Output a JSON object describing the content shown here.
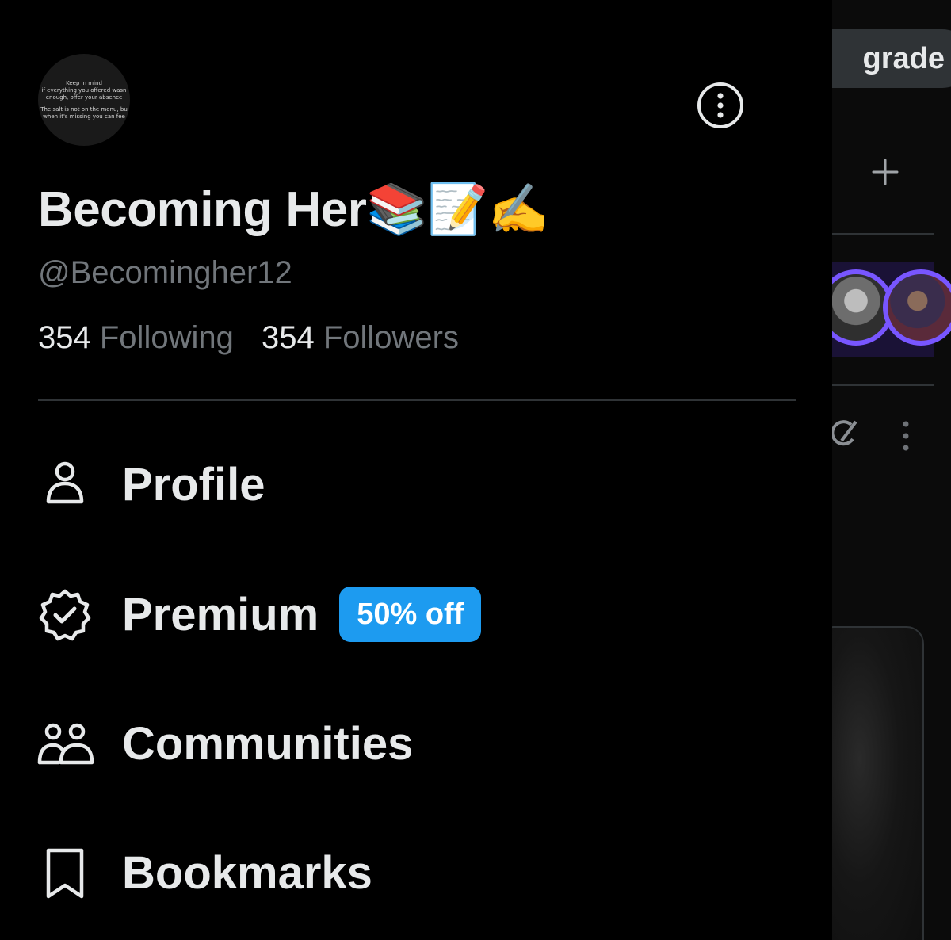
{
  "profile": {
    "display_name": "Becoming Her📚📝✍️",
    "handle": "@Becomingher12",
    "following_count": "354",
    "following_label": "Following",
    "followers_count": "354",
    "followers_label": "Followers",
    "avatar_text": [
      "Keep in mind",
      "if everything you offered wasn",
      "enough, offer your absence",
      "The salt is not on the menu, bu",
      "when it's missing you can fee"
    ]
  },
  "menu": {
    "items": [
      {
        "label": "Profile",
        "icon": "person-icon"
      },
      {
        "label": "Premium",
        "icon": "verified-badge-icon",
        "badge": "50% off"
      },
      {
        "label": "Communities",
        "icon": "communities-icon"
      },
      {
        "label": "Bookmarks",
        "icon": "bookmark-icon"
      }
    ]
  },
  "background": {
    "upgrade_label": "grade"
  },
  "colors": {
    "background": "#000000",
    "text_primary": "#e7e9ea",
    "text_secondary": "#71767b",
    "divider": "#2f3336",
    "accent": "#1d9bf0"
  }
}
